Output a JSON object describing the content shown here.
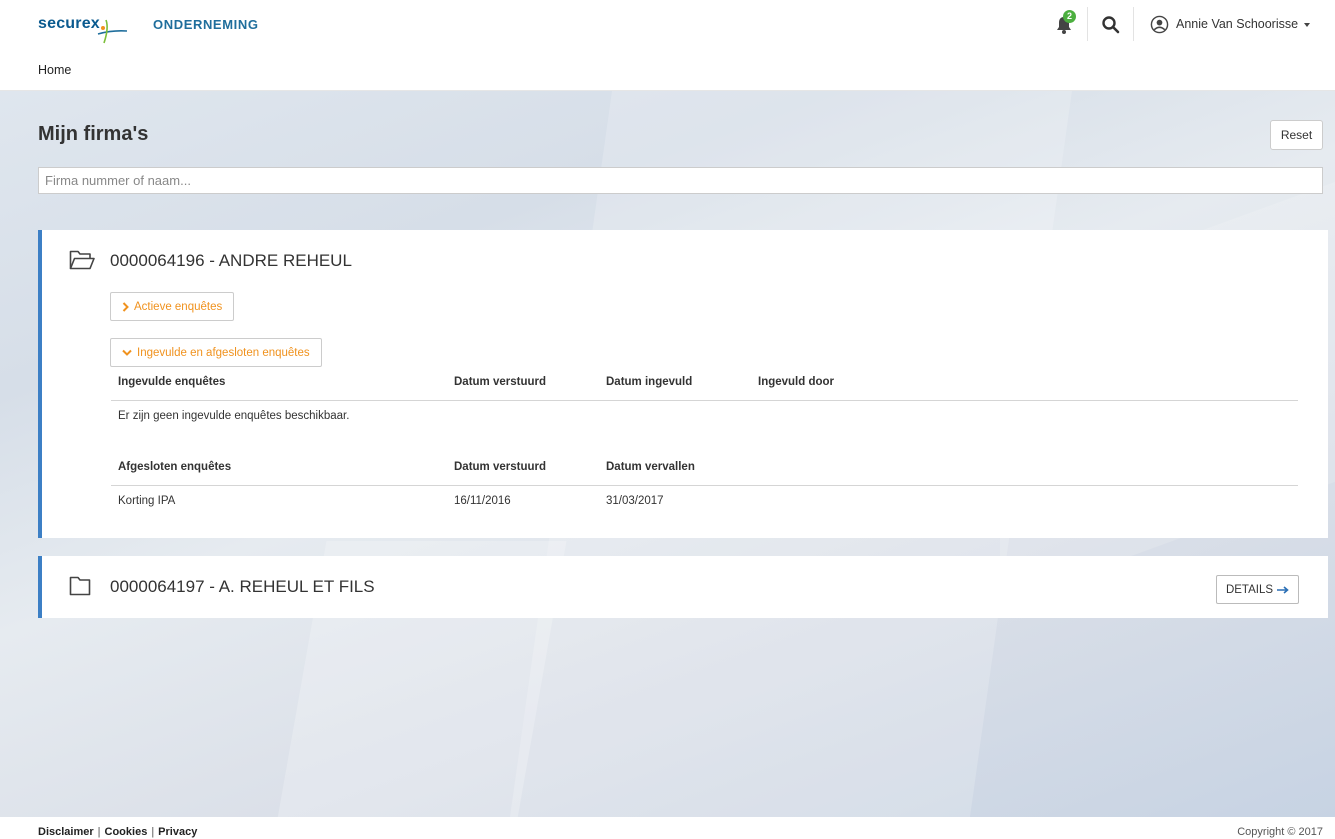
{
  "header": {
    "logo_text": "securex",
    "brand": "ONDERNEMING",
    "notification_count": "2",
    "user_name": "Annie Van Schoorisse"
  },
  "subnav": {
    "home": "Home"
  },
  "main": {
    "title": "Mijn firma's",
    "reset_label": "Reset",
    "search_placeholder": "Firma nummer of naam..."
  },
  "companies": [
    {
      "title": "0000064196 - ANDRE REHEUL",
      "active_btn": "Actieve enquêtes",
      "closed_btn": "Ingevulde en afgesloten enquêtes",
      "filled": {
        "headers": [
          "Ingevulde enquêtes",
          "Datum verstuurd",
          "Datum ingevuld",
          "Ingevuld door"
        ],
        "empty_text": "Er zijn geen ingevulde enquêtes beschikbaar."
      },
      "closed": {
        "headers": [
          "Afgesloten enquêtes",
          "Datum verstuurd",
          "Datum vervallen"
        ],
        "rows": [
          [
            "Korting IPA",
            "16/11/2016",
            "31/03/2017"
          ]
        ]
      }
    },
    {
      "title": "0000064197 - A. REHEUL ET FILS",
      "details_label": "DETAILS"
    }
  ],
  "footer": {
    "links": [
      "Disclaimer",
      "Cookies",
      "Privacy"
    ],
    "copyright": "Copyright © 2017"
  },
  "colors": {
    "accent_blue": "#3c7fc5",
    "orange": "#f0921e",
    "badge_green": "#4caf3f",
    "brand_blue": "#1f6e9c"
  }
}
